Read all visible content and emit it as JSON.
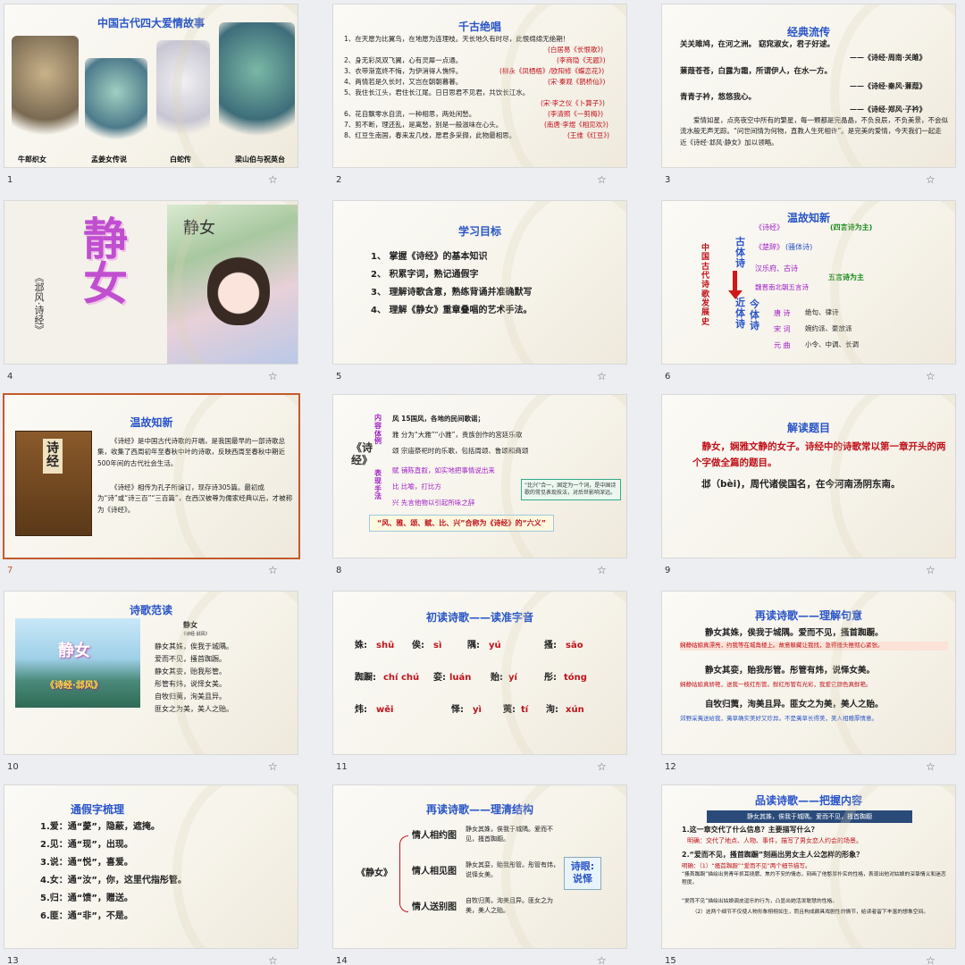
{
  "star_icon": "☆",
  "slides": [
    {
      "num": "1",
      "title": "中国古代四大爱情故事",
      "captions": [
        "牛郎织女",
        "孟姜女传说",
        "白蛇传",
        "梁山伯与祝英台"
      ]
    },
    {
      "num": "2",
      "title": "千古绝唱",
      "lines": [
        "1、在天愿为比翼鸟，在地愿为连理枝。天长地久有时尽，此恨绵绵无绝期！",
        "(白居易《长恨歌》)",
        "2、身无彩凤双飞翼，心有灵犀一点通。",
        "(李商隐《无题》)",
        "3、衣带渐宽终不悔，为伊消得人憔悴。",
        "(柳永《凤栖梧》/欧阳修《蝶恋花》)",
        "4、两情若是久长时，又岂在朝朝暮暮。",
        "(宋·秦观《鹊桥仙》)",
        "5、我住长江头，君住长江尾。日日思君不见君，共饮长江水。",
        "(宋·李之仪《卜算子》)",
        "6、花自飘零水自流，一种相思，两处闲愁。",
        "(李清照《一剪梅》)",
        "7、剪不断，理还乱，是离愁，别是一般滋味在心头。",
        "(南唐·李煜《相见欢》)",
        "8、红豆生南国，春来发几枝，愿君多采撷，此物最相思。",
        "(王维《红豆》)"
      ]
    },
    {
      "num": "3",
      "title": "经典流传",
      "lines": [
        "关关雎鸠，在河之洲。 窈窕淑女，君子好逑。",
        "——《诗经·周南·关雎》",
        "蒹葭苍苍，白露为霜，所谓伊人，在水一方。",
        "——《诗经·秦风·蒹葭》",
        "青青子衿，悠悠我心。",
        "——《诗经·郑风·子衿》"
      ],
      "para": "爱情如星，点亮夜空中所有的繁星，每一颗都是完晶晶，不负良辰，不负美景，不会似流水般无声无踪。“问世间情为何物，直教人生死相许”。是完美的爱情，今天我们一起走近《诗经·邶风·静女》加以领略。"
    },
    {
      "num": "4",
      "big": "静女",
      "side": "《邶风·诗经》",
      "pic_label": "静女"
    },
    {
      "num": "5",
      "title": "学习目标",
      "items": [
        "1、 掌握《诗经》的基本知识",
        "2、 积累字词，熟记通假字",
        "3、 理解诗歌含意，熟练背诵并准确默写",
        "4、 理解《静女》重章叠唱的艺术手法。"
      ]
    },
    {
      "num": "6",
      "title": "温故知新",
      "vert": "中国古代诗歌发展史",
      "labels": [
        "《诗经》",
        "(四言诗为主)",
        "《楚辞》",
        "(骚体诗)",
        "古体诗",
        "汉乐府、古诗",
        "魏晋南北朝五言诗",
        "五言诗为主",
        "近体诗",
        "今体诗",
        "唐 诗",
        "绝句、律诗",
        "宋 词",
        "婉约派、豪放派",
        "元 曲",
        "小令、中调、长调"
      ]
    },
    {
      "num": "7",
      "title": "温故知新",
      "book": "诗经",
      "p1": "《诗经》是中国古代诗歌的开端，是我国最早的一部诗歌总集，收集了西周初年至春秋中叶的诗歌，反映西周至春秋中期近500年间的古代社会生活。",
      "p2": "《诗经》相传为孔子所编订，现存诗305篇。最初成为“诗”或“诗三百”“三百篇”，在西汉被尊为儒家经典以后，才被称为《诗经》。"
    },
    {
      "num": "8",
      "side": "《诗经》",
      "g1": "内容体例",
      "g2": "表现手法",
      "rows": [
        "风 15国风，各地的民间歌谣；",
        "雅 分为“大雅”“小雅”，贵族创作的宫廷乐歌",
        "颂 宗庙祭祀时的乐歌，包括周颂、鲁颂和商颂",
        "赋 铺陈直叙，如实地把事情说出来",
        "比 比喻，打比方",
        "兴 先言他物以引起所咏之辞"
      ],
      "note": "“比兴”合一，固定为一个词，是中国诗歌的常见表现技法，对后世影响深远。",
      "footer": "“风、雅、颂、赋、比、兴”合称为《诗经》的“六义”"
    },
    {
      "num": "9",
      "title": "解读题目",
      "p1": "静女，娴雅文静的女子。诗经中的诗歌常以第一章开头的两个字做全篇的题目。",
      "p2": "邶（bèi)，周代诸侯国名，在今河南汤阴东南。"
    },
    {
      "num": "10",
      "title": "诗歌范读",
      "img_title": "静女",
      "img_sub": "《诗经·邶风》",
      "poem_title": "静女",
      "poem_src": "《诗经·邶风》",
      "poem": [
        "静女其姝，俟我于城隅。",
        "爱而不见，搔首踟蹰。",
        "静女其娈，贻我彤管。",
        "彤管有炜，说怿女美。",
        "自牧归荑，洵美且异。",
        "匪女之为美，美人之贻。"
      ]
    },
    {
      "num": "11",
      "title": "初读诗歌——读准字音",
      "pairs": [
        [
          "姝:",
          "shū"
        ],
        [
          "俟:",
          "sì"
        ],
        [
          "隅:",
          "yú"
        ],
        [
          "搔:",
          "sāo"
        ],
        [
          "踟蹰:",
          "chí chú"
        ],
        [
          "娈:",
          "luán"
        ],
        [
          "贻:",
          "yí"
        ],
        [
          "彤:",
          "tóng"
        ],
        [
          "炜:",
          "wěi"
        ],
        [
          "怿:",
          "yì"
        ],
        [
          "荑:",
          "tí"
        ],
        [
          "洵:",
          "xún"
        ]
      ]
    },
    {
      "num": "12",
      "title": "再读诗歌——理解句意",
      "l1": "静女其姝，俟我于城隅。爱而不见，搔首踟蹰。",
      "e1": "娴静姑娘真漂亮，约我等在城角楼上。故意躲藏让我找，急得搔头推彻心紧张。",
      "l2": "静女其娈，贻我彤管。彤管有炜，说怿女美。",
      "e2": "娴静姑娘真娇艳，送我一枝红彤管。鲜红彤管有光彩，我爱它颜色真鲜艳。",
      "l3": "自牧归荑，洵美且异。匪女之为美，美人之贻。",
      "e3": "郊野采荑送给我，荑草确实美好又珍异。不是荑草长得美，美人相赠厚情意。"
    },
    {
      "num": "13",
      "title": "通假字梳理",
      "items": [
        "1.爱：通“薆”，隐蔽，遮掩。",
        "2.见：通“现”，出现。",
        "3.说：通“悦”，喜爱。",
        "4.女：通“汝”，你，这里代指彤管。",
        "5.归：通“馈”，赠送。",
        "6.匪：通“非”，不是。"
      ]
    },
    {
      "num": "14",
      "title": "再读诗歌——理清结构",
      "poem": "《静女》",
      "parts": [
        "情人相约图",
        "情人相见图",
        "情人送别图"
      ],
      "texts": [
        "静女其姝，俟我于城隅。爱而不见，搔首踟蹰。",
        "静女其娈，贻我彤管。彤管有炜，说怿女美。",
        "自牧归荑，洵美且异。匪女之为美，美人之贻。"
      ],
      "eye": "诗眼:说怿"
    },
    {
      "num": "15",
      "title": "品读诗歌——把握内容",
      "banner": "静女其姝，俟我于城隅。爱而不见，搔首踟蹰",
      "q1": "1.这一章交代了什么信息？主要描写什么？",
      "a1": "明确：交代了地点、人物、事件，描写了男女恋人约会的场景。",
      "q2": "2.“爱而不见，搔首踟蹰”刻画出男女主人公怎样的形象？",
      "a2": "明确：（1）“搔首踟蹰”“爱而不见”两个细节描写。",
      "a3": "“搔首踟蹰”描绘出男青年抓耳挠腮、焦灼不安的情态，刻画了他憨厚朴实的性格，表现出他对姑娘的深挚情义和迷恋程度。",
      "a4": "“爱而不见”描绘出姑娘调皮逗乐的行为，凸显出她活泼聪慧的性格。",
      "a5": "（2）这两个细节不仅使人物形象栩栩如生，而且构成颇具戏剧性的情节，给读者留下丰富的想象空间。"
    }
  ]
}
